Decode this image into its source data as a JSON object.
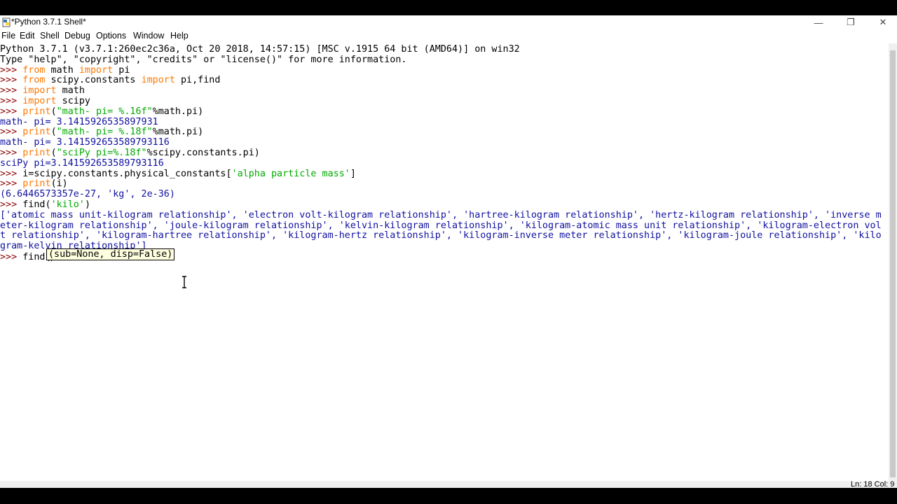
{
  "window": {
    "title": "*Python 3.7.1 Shell*",
    "controls": {
      "minimize": "—",
      "maximize": "❐",
      "close": "✕"
    }
  },
  "menu": [
    "File",
    "Edit",
    "Shell",
    "Debug",
    "Options",
    "Window",
    "Help"
  ],
  "shell": {
    "banner": [
      "Python 3.7.1 (v3.7.1:260ec2c36a, Oct 20 2018, 14:57:15) [MSC v.1915 64 bit (AMD64)] on win32",
      "Type \"help\", \"copyright\", \"credits\" or \"license()\" for more information."
    ],
    "prompt": ">>> ",
    "lines": [
      {
        "kind": "input",
        "segments": [
          {
            "t": "from",
            "c": "kw"
          },
          {
            "t": " math ",
            "c": ""
          },
          {
            "t": "import",
            "c": "kw"
          },
          {
            "t": " pi",
            "c": ""
          }
        ]
      },
      {
        "kind": "input",
        "segments": [
          {
            "t": "from",
            "c": "kw"
          },
          {
            "t": " scipy.constants ",
            "c": ""
          },
          {
            "t": "import",
            "c": "kw"
          },
          {
            "t": " pi,find",
            "c": ""
          }
        ]
      },
      {
        "kind": "input",
        "segments": [
          {
            "t": "import",
            "c": "kw"
          },
          {
            "t": " math",
            "c": ""
          }
        ]
      },
      {
        "kind": "input",
        "segments": [
          {
            "t": "import",
            "c": "kw"
          },
          {
            "t": " scipy",
            "c": ""
          }
        ]
      },
      {
        "kind": "input",
        "segments": [
          {
            "t": "print",
            "c": "kw"
          },
          {
            "t": "(",
            "c": ""
          },
          {
            "t": "\"math- pi= %.16f\"",
            "c": "str"
          },
          {
            "t": "%math.pi)",
            "c": ""
          }
        ]
      },
      {
        "kind": "output",
        "text": "math- pi= 3.1415926535897931"
      },
      {
        "kind": "input",
        "segments": [
          {
            "t": "print",
            "c": "kw"
          },
          {
            "t": "(",
            "c": ""
          },
          {
            "t": "\"math- pi= %.18f\"",
            "c": "str"
          },
          {
            "t": "%math.pi)",
            "c": ""
          }
        ]
      },
      {
        "kind": "output",
        "text": "math- pi= 3.141592653589793116"
      },
      {
        "kind": "input",
        "segments": [
          {
            "t": "print",
            "c": "kw"
          },
          {
            "t": "(",
            "c": ""
          },
          {
            "t": "\"sciPy pi=%.18f\"",
            "c": "str"
          },
          {
            "t": "%scipy.constants.pi)",
            "c": ""
          }
        ]
      },
      {
        "kind": "output",
        "text": "sciPy pi=3.141592653589793116"
      },
      {
        "kind": "input",
        "segments": [
          {
            "t": "i=scipy.constants.physical_constants[",
            "c": ""
          },
          {
            "t": "'alpha particle mass'",
            "c": "str"
          },
          {
            "t": "]",
            "c": ""
          }
        ]
      },
      {
        "kind": "input",
        "segments": [
          {
            "t": "print",
            "c": "kw"
          },
          {
            "t": "(i)",
            "c": ""
          }
        ]
      },
      {
        "kind": "output",
        "text": "(6.6446573357e-27, 'kg', 2e-36)"
      },
      {
        "kind": "input",
        "segments": [
          {
            "t": "find(",
            "c": ""
          },
          {
            "t": "'kilo'",
            "c": "str"
          },
          {
            "t": ")",
            "c": ""
          }
        ]
      },
      {
        "kind": "output",
        "text": "['atomic mass unit-kilogram relationship', 'electron volt-kilogram relationship', 'hartree-kilogram relationship', 'hertz-kilogram relationship', 'inverse m"
      },
      {
        "kind": "output",
        "text": "eter-kilogram relationship', 'joule-kilogram relationship', 'kelvin-kilogram relationship', 'kilogram-atomic mass unit relationship', 'kilogram-electron vol"
      },
      {
        "kind": "output",
        "text": "t relationship', 'kilogram-hartree relationship', 'kilogram-hertz relationship', 'kilogram-inverse meter relationship', 'kilogram-joule relationship', 'kilo"
      },
      {
        "kind": "output",
        "text": "gram-kelvin relationship']"
      },
      {
        "kind": "current",
        "segments": [
          {
            "t": "find(",
            "c": ""
          }
        ]
      }
    ],
    "calltip": "(sub=None, disp=False)"
  },
  "status": "Ln: 18  Col: 9"
}
